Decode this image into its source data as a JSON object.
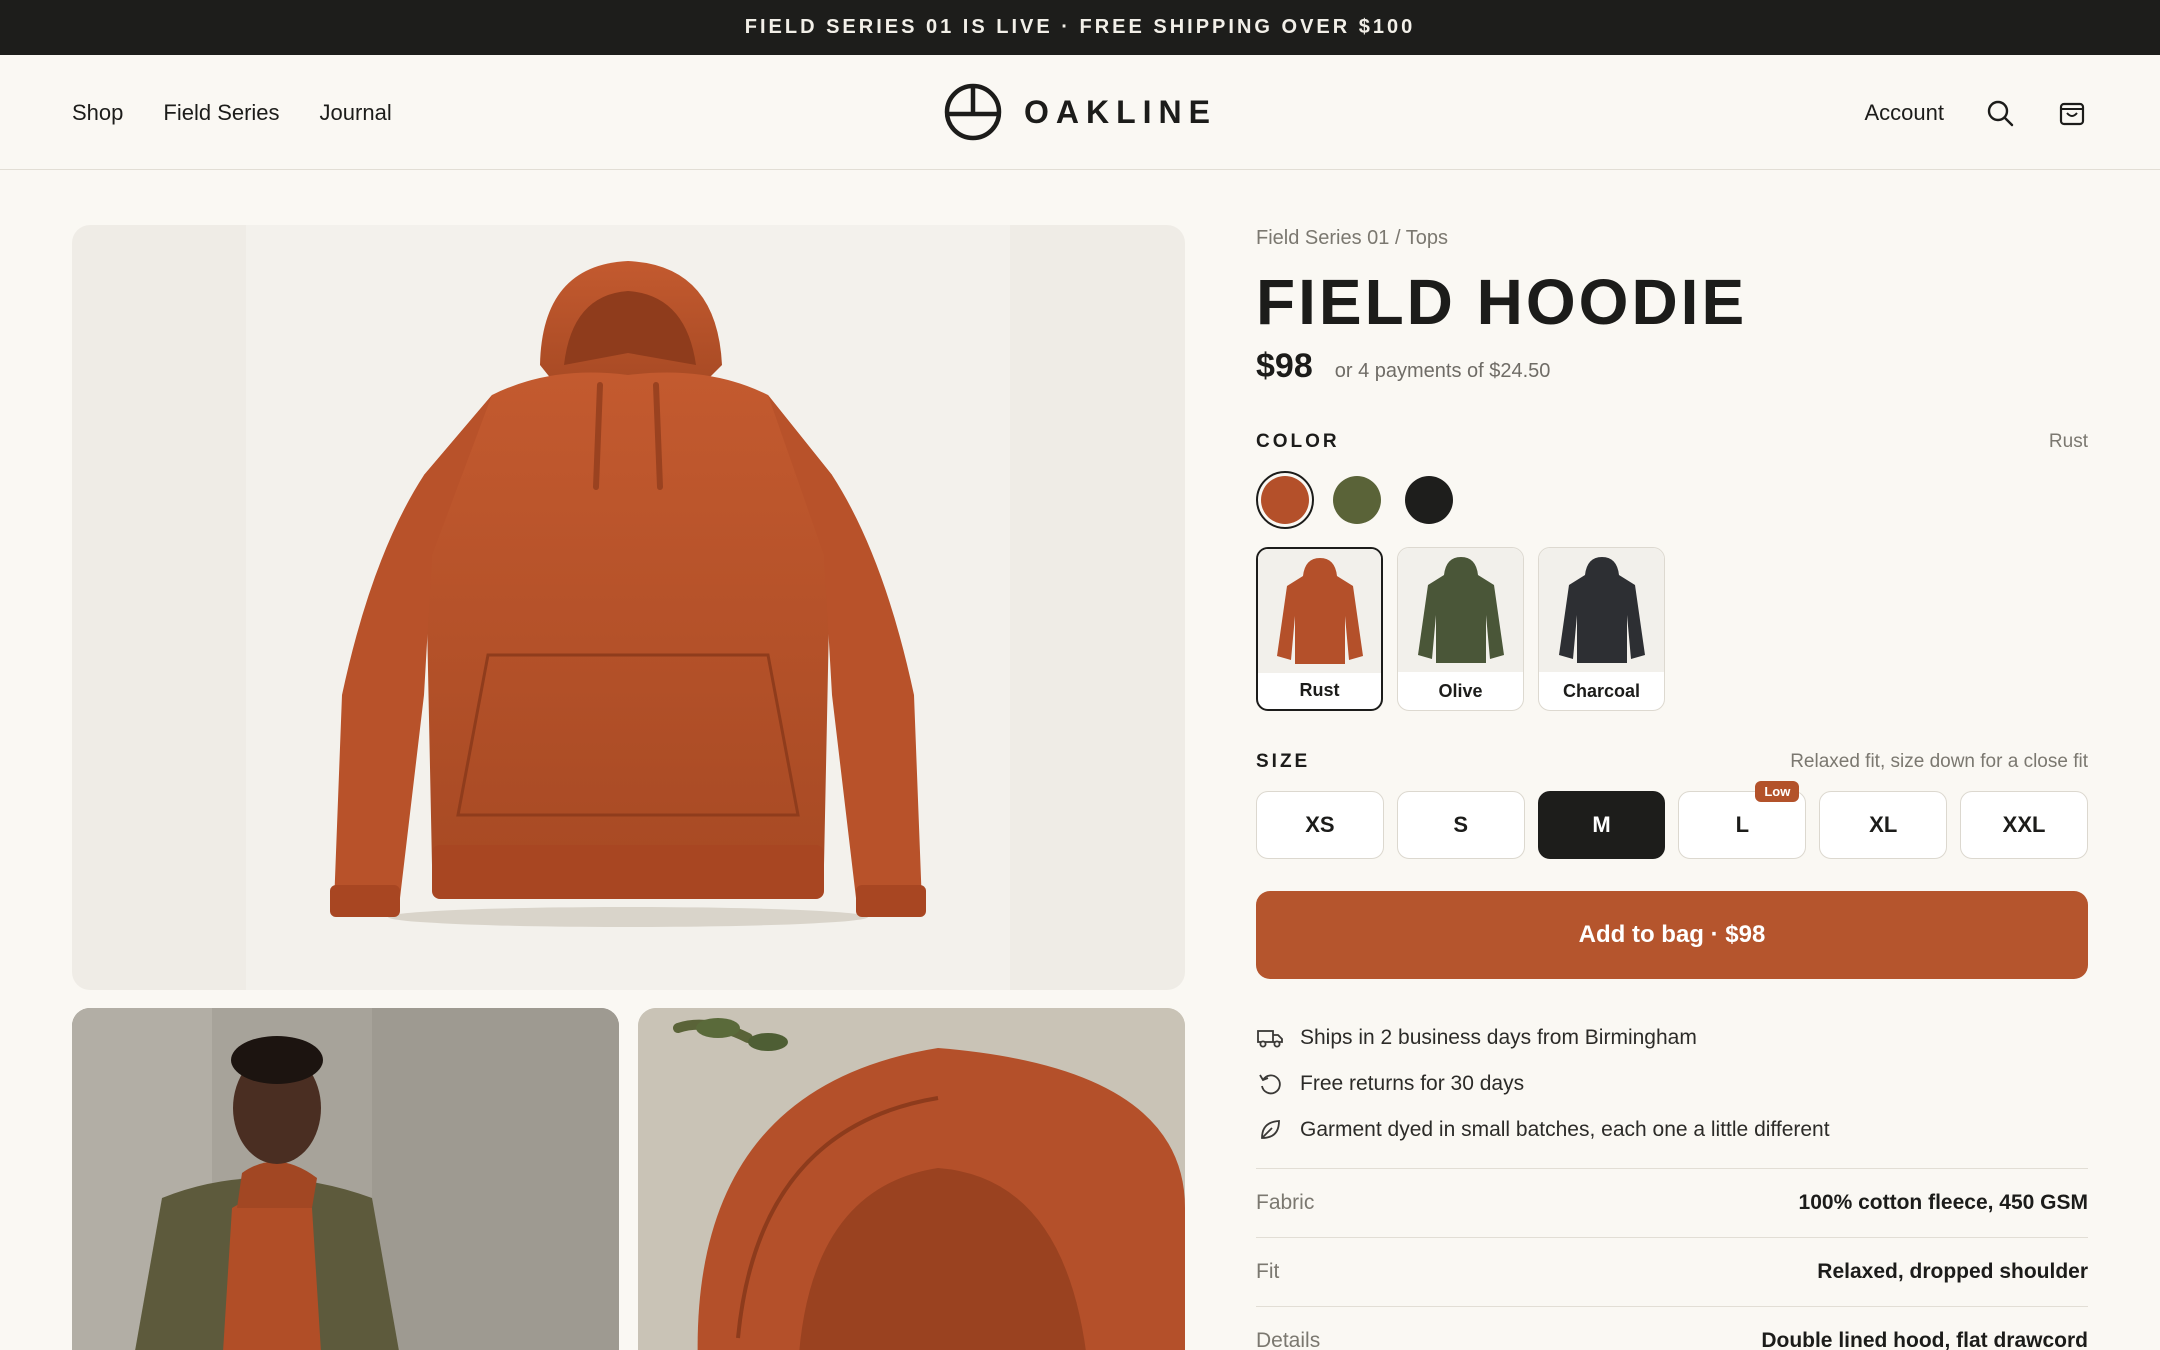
{
  "announcement": "FIELD SERIES 01 IS LIVE · FREE SHIPPING OVER $100",
  "nav": {
    "left": [
      "Shop",
      "Field Series",
      "Journal"
    ],
    "brand": "OAKLINE",
    "account": "Account",
    "search_icon": "search-icon",
    "bag_icon": "shopping-bag-icon"
  },
  "product": {
    "breadcrumb": "Field Series 01 / Tops",
    "title": "FIELD HOODIE",
    "price": "$98",
    "installments": "or 4 payments of $24.50",
    "color_label": "COLOR",
    "selected_color": "Rust",
    "colors": [
      {
        "name": "Rust",
        "hex": "#b4502a"
      },
      {
        "name": "Olive",
        "hex": "#5a6338"
      },
      {
        "name": "Charcoal",
        "hex": "#1e1e1c"
      }
    ],
    "color_cards": [
      {
        "name": "Rust",
        "hex": "#b4502a"
      },
      {
        "name": "Olive",
        "hex": "#4a5638"
      },
      {
        "name": "Charcoal",
        "hex": "#2d2f33"
      }
    ],
    "size_label": "SIZE",
    "size_hint": "Relaxed fit, size down for a close fit",
    "sizes": [
      "XS",
      "S",
      "M",
      "L",
      "XL",
      "XXL"
    ],
    "selected_size": "M",
    "low_stock_badge": "Low",
    "add_to_bag": "Add to bag · $98",
    "perks": [
      {
        "icon": "truck-icon",
        "text": "Ships in 2 business days from Birmingham"
      },
      {
        "icon": "returns-icon",
        "text": "Free returns for 30 days"
      },
      {
        "icon": "leaf-icon",
        "text": "Garment dyed in small batches, each one a little different"
      }
    ],
    "specs": [
      {
        "key": "Fabric",
        "value": "100% cotton fleece, 450 GSM"
      },
      {
        "key": "Fit",
        "value": "Relaxed, dropped shoulder"
      },
      {
        "key": "Details",
        "value": "Double lined hood, flat drawcord"
      }
    ]
  },
  "colors": {
    "accent": "#b5552d",
    "dark": "#1d1d1b",
    "background": "#faf8f3"
  }
}
